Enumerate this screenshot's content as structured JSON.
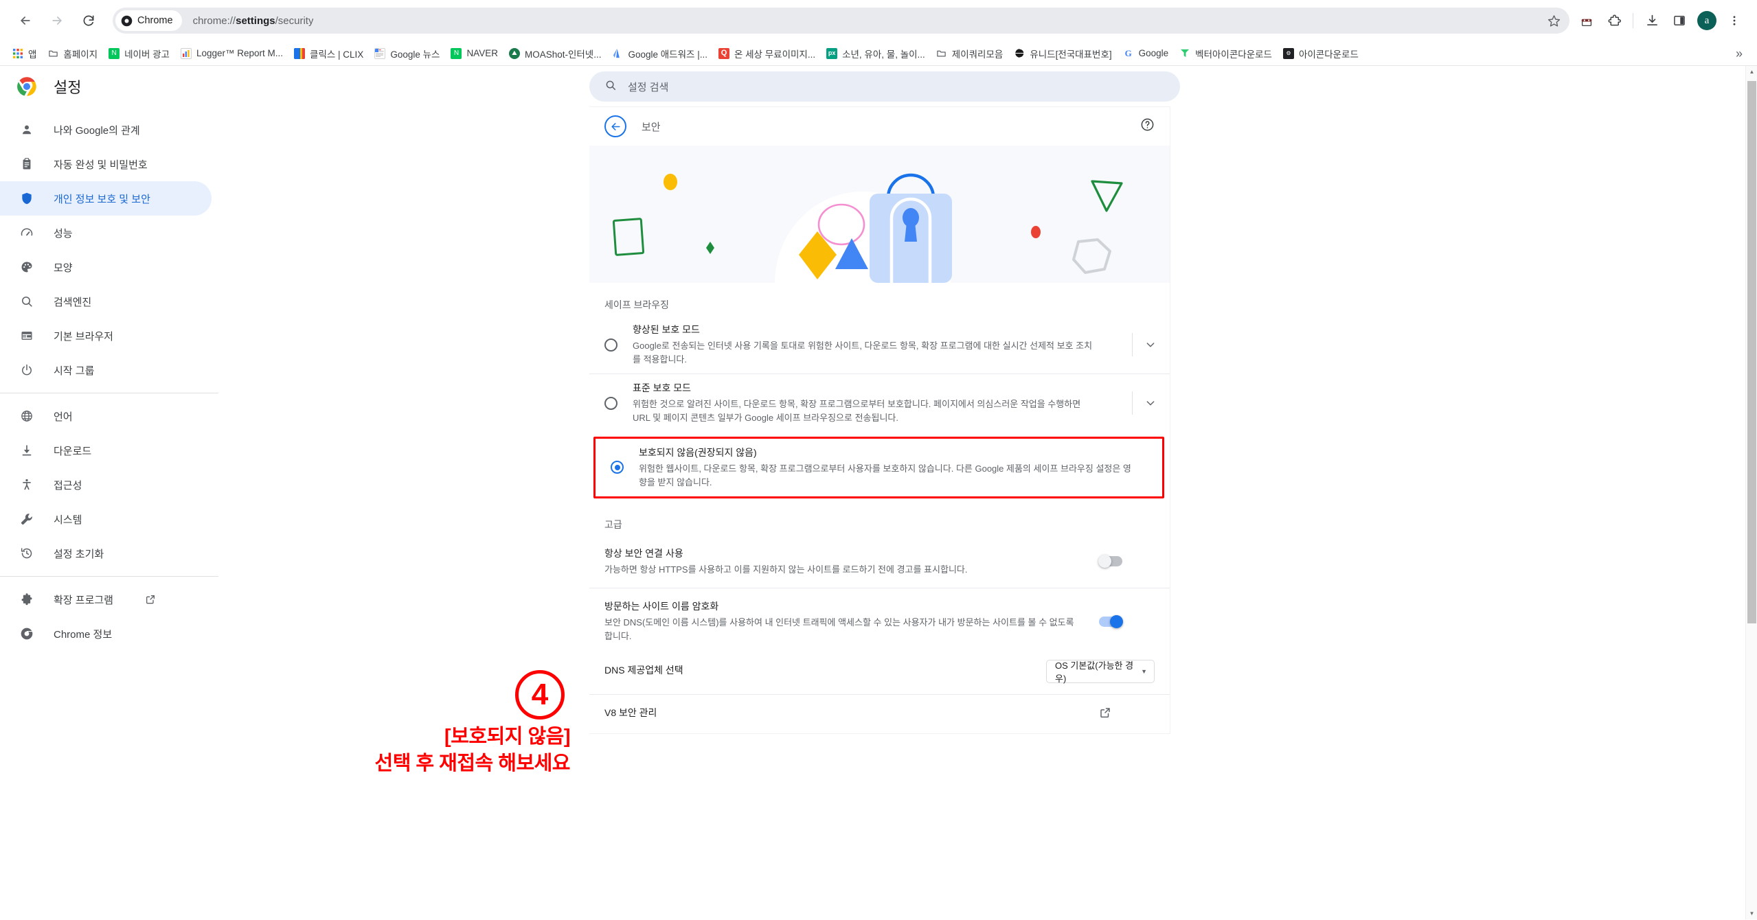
{
  "browser": {
    "back_tooltip": "뒤로",
    "forward_tooltip": "앞으로",
    "reload_tooltip": "새로고침",
    "chip_label": "Chrome",
    "url_prefix": "chrome://",
    "url_bold": "settings",
    "url_suffix": "/security",
    "url_full": "chrome://settings/security",
    "avatar_letter": "a",
    "overflow_label": "»"
  },
  "bookmarks": [
    {
      "label": "앱",
      "icon": "apps-grid-icon",
      "color": "#4285f4"
    },
    {
      "label": "홈페이지",
      "icon": "folder-icon",
      "color": "#5f6368"
    },
    {
      "label": "네이버 광고",
      "icon": "naver-icon",
      "color": "#03c75a",
      "glyph": "N"
    },
    {
      "label": "Logger™ Report M...",
      "icon": "chart-icon",
      "color": "#ffffff"
    },
    {
      "label": "클릭스 | CLIX",
      "icon": "clix-icon",
      "color": "#1a73e8"
    },
    {
      "label": "Google 뉴스",
      "icon": "google-news-icon",
      "color": "#ffffff"
    },
    {
      "label": "NAVER",
      "icon": "naver-icon",
      "color": "#03c75a",
      "glyph": "N"
    },
    {
      "label": "MOAShot-인터넷...",
      "icon": "moashot-icon",
      "color": "#1a7a4c"
    },
    {
      "label": "Google 애드워즈 |...",
      "icon": "adwords-icon",
      "color": "#4285f4"
    },
    {
      "label": "온 세상 무료이미지...",
      "icon": "q-icon",
      "color": "#ea4335",
      "glyph": "Q"
    },
    {
      "label": "소년, 유아, 물, 놀이...",
      "icon": "pexels-icon",
      "color": "#05a081",
      "glyph": "px"
    },
    {
      "label": "제이쿼리모음",
      "icon": "folder-icon",
      "color": "#5f6368"
    },
    {
      "label": "유니드[전국대표번호]",
      "icon": "globe-icon",
      "color": "#1a1a1a"
    },
    {
      "label": "Google",
      "icon": "google-g-icon",
      "color": "#4285f4",
      "glyph": "G"
    },
    {
      "label": "벡터아이콘다운로드",
      "icon": "flaticon-icon",
      "color": "#2ecc71"
    },
    {
      "label": "아이콘다운로드",
      "icon": "icon-download-icon",
      "color": "#202124"
    }
  ],
  "settings": {
    "brand_title": "설정",
    "brand_icon": "chrome-logo-icon",
    "search": {
      "placeholder": "설정 검색",
      "icon": "search-icon",
      "value": ""
    },
    "nav": {
      "items": [
        {
          "label": "나와 Google의 관계",
          "icon": "person-icon",
          "active": false
        },
        {
          "label": "자동 완성 및 비밀번호",
          "icon": "clipboard-icon",
          "active": false
        },
        {
          "label": "개인 정보 보호 및 보안",
          "icon": "shield-icon",
          "active": true
        },
        {
          "label": "성능",
          "icon": "speedometer-icon",
          "active": false
        },
        {
          "label": "모양",
          "icon": "palette-icon",
          "active": false
        },
        {
          "label": "검색엔진",
          "icon": "search-icon",
          "active": false
        },
        {
          "label": "기본 브라우저",
          "icon": "browser-window-icon",
          "active": false
        },
        {
          "label": "시작 그룹",
          "icon": "power-icon",
          "active": false
        }
      ],
      "items2": [
        {
          "label": "언어",
          "icon": "globe-icon"
        },
        {
          "label": "다운로드",
          "icon": "download-icon"
        },
        {
          "label": "접근성",
          "icon": "accessibility-icon"
        },
        {
          "label": "시스템",
          "icon": "wrench-icon"
        },
        {
          "label": "설정 초기화",
          "icon": "restore-icon"
        }
      ],
      "items3": [
        {
          "label": "확장 프로그램",
          "icon": "puzzle-icon",
          "external": true
        },
        {
          "label": "Chrome 정보",
          "icon": "chrome-logo-icon",
          "external": false
        }
      ]
    }
  },
  "security": {
    "header_title": "보안",
    "back_icon": "arrow-back-icon",
    "help_icon": "help-circle-icon",
    "hero_icon": "padlock-illustration",
    "safe_browsing": {
      "group_title": "세이프 브라우징",
      "options": [
        {
          "title": "향상된 보호 모드",
          "desc": "Google로 전송되는 인터넷 사용 기록을 토대로 위험한 사이트, 다운로드 항목, 확장 프로그램에 대한 실시간 선제적 보호 조치를 적용합니다.",
          "selected": false,
          "expand_icon": "chevron-down-icon",
          "highlighted": false
        },
        {
          "title": "표준 보호 모드",
          "desc": "위험한 것으로 알려진 사이트, 다운로드 항목, 확장 프로그램으로부터 보호합니다. 페이지에서 의심스러운 작업을 수행하면 URL 및 페이지 콘텐츠 일부가 Google 세이프 브라우징으로 전송됩니다.",
          "selected": false,
          "expand_icon": "chevron-down-icon",
          "highlighted": false
        },
        {
          "title": "보호되지 않음(권장되지 않음)",
          "desc": "위험한 웹사이트, 다운로드 항목, 확장 프로그램으로부터 사용자를 보호하지 않습니다. 다른 Google 제품의 세이프 브라우징 설정은 영향을 받지 않습니다.",
          "selected": true,
          "expand_icon": "",
          "highlighted": true
        }
      ]
    },
    "advanced": {
      "group_title": "고급",
      "rows": [
        {
          "title": "항상 보안 연결 사용",
          "desc": "가능하면 항상 HTTPS를 사용하고 이를 지원하지 않는 사이트를 로드하기 전에 경고를 표시합니다.",
          "control": "toggle",
          "value": "off"
        },
        {
          "title": "방문하는 사이트 이름 암호화",
          "desc": "보안 DNS(도메인 이름 시스템)를 사용하여 내 인터넷 트래픽에 액세스할 수 있는 사용자가 내가 방문하는 사이트를 볼 수 없도록 합니다.",
          "control": "toggle",
          "value": "on"
        },
        {
          "title": "DNS 제공업체 선택",
          "desc": "",
          "control": "select",
          "value": "OS 기본값(가능한 경우)"
        },
        {
          "title": "V8 보안 관리",
          "desc": "",
          "control": "external-link",
          "value": ""
        }
      ]
    }
  },
  "annotation": {
    "number": "4",
    "line1": "[보호되지 않음]",
    "line2": "선택 후 재접속 해보세요",
    "color": "#ff0000"
  },
  "colors": {
    "accent": "#1a73e8",
    "active_bg": "#e8f0fe",
    "active_fg": "#1967d2",
    "annotation": "#ff0000",
    "hero_bg": "#f7f9fc"
  }
}
